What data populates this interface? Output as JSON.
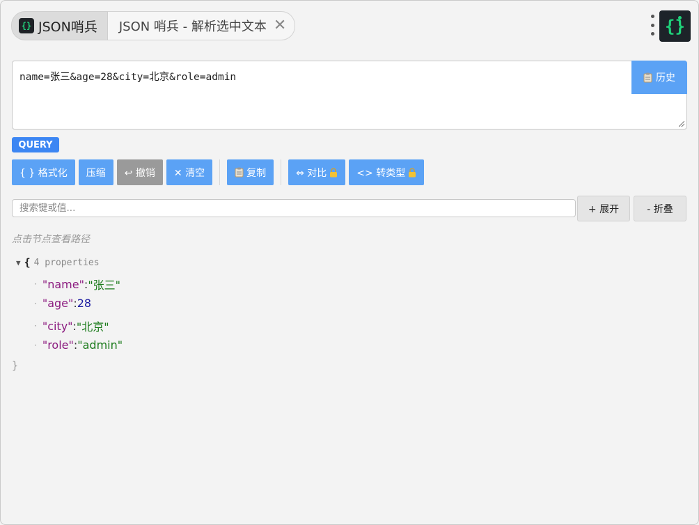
{
  "header": {
    "brand": "JSON哨兵",
    "brand_logo": "{}",
    "tab_title": "JSON 哨兵 - 解析选中文本",
    "close_glyph": "✕",
    "app_icon_glyph": "{}"
  },
  "input": {
    "value": "name=张三&age=28&city=北京&role=admin",
    "history_label": "历史",
    "history_icon": "clipboard-icon"
  },
  "badge": "QUERY",
  "toolbar": {
    "format": "{ } 格式化",
    "compress": "压缩",
    "undo": "↩ 撤销",
    "clear": "✕ 清空",
    "copy": "复制",
    "compare": "⇔ 对比",
    "convert": "<> 转类型",
    "lock_icon": "lock-icon"
  },
  "search": {
    "placeholder": "搜索键或值...",
    "expand": "+ 展开",
    "collapse": "- 折叠"
  },
  "hint": "点击节点查看路径",
  "tree": {
    "caret": "▼",
    "open": "{",
    "count": "4 properties",
    "close": "}",
    "rows": [
      {
        "key": "\"name\"",
        "value": "\"张三\"",
        "type": "string"
      },
      {
        "key": "\"age\"",
        "value": "28",
        "type": "number"
      },
      {
        "key": "\"city\"",
        "value": "\"北京\"",
        "type": "string"
      },
      {
        "key": "\"role\"",
        "value": "\"admin\"",
        "type": "string"
      }
    ]
  },
  "colors": {
    "accent": "#5ba2f5",
    "badge": "#3c86f3",
    "key": "#8b1a7f",
    "string": "#1a7a1a",
    "number": "#1a1aa0"
  }
}
